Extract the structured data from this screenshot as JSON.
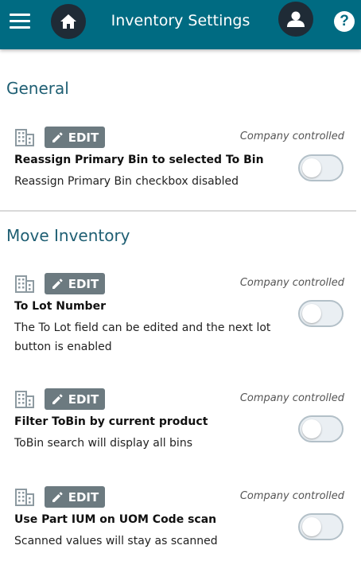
{
  "header": {
    "title": "Inventory Settings",
    "help_label": "?",
    "background_color": "#006b82"
  },
  "sections": [
    {
      "title": "General",
      "settings": [
        {
          "edit_label": "EDIT",
          "controlled_label": "Company controlled",
          "title": "Reassign Primary Bin to selected To Bin",
          "description": "Reassign Primary Bin checkbox disabled",
          "enabled": false
        }
      ]
    },
    {
      "title": "Move Inventory",
      "settings": [
        {
          "edit_label": "EDIT",
          "controlled_label": "Company controlled",
          "title": "To Lot Number",
          "description": "The To Lot field can be edited and the next lot button is enabled",
          "enabled": false
        },
        {
          "edit_label": "EDIT",
          "controlled_label": "Company controlled",
          "title": "Filter ToBin by current product",
          "description": "ToBin search will display all bins",
          "enabled": false
        },
        {
          "edit_label": "EDIT",
          "controlled_label": "Company controlled",
          "title": "Use Part IUM on UOM Code scan",
          "description": "Scanned values will stay as scanned",
          "enabled": false
        }
      ]
    }
  ]
}
